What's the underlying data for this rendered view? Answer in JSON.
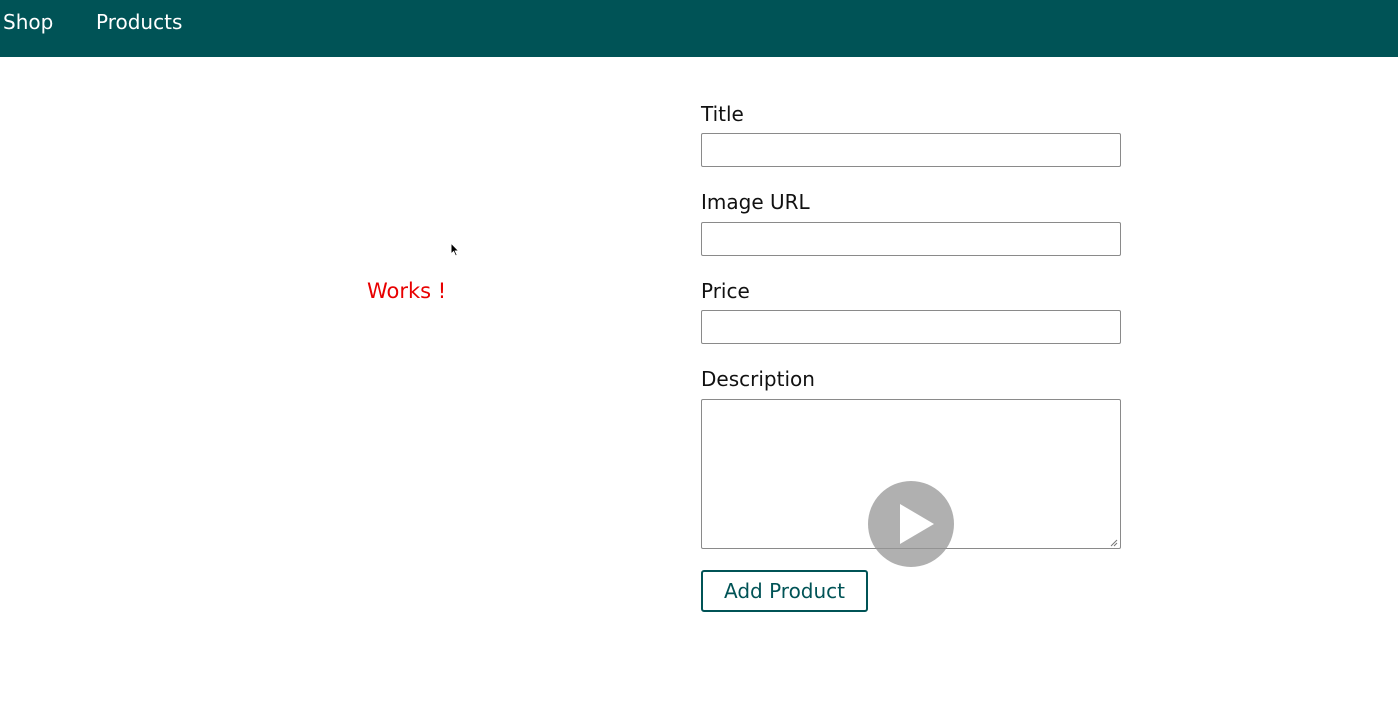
{
  "header": {
    "nav_items": [
      {
        "label": "Shop"
      },
      {
        "label": "Products"
      }
    ],
    "background_color": "#005356"
  },
  "main": {
    "status_text": "Works !",
    "status_color": "#e80000"
  },
  "form": {
    "title": {
      "label": "Title",
      "value": ""
    },
    "image_url": {
      "label": "Image URL",
      "value": ""
    },
    "price": {
      "label": "Price",
      "value": ""
    },
    "description": {
      "label": "Description",
      "value": ""
    },
    "submit_label": "Add Product"
  },
  "overlay": {
    "play_icon": "play-icon"
  },
  "cursor": {
    "icon": "mouse-pointer-icon"
  }
}
